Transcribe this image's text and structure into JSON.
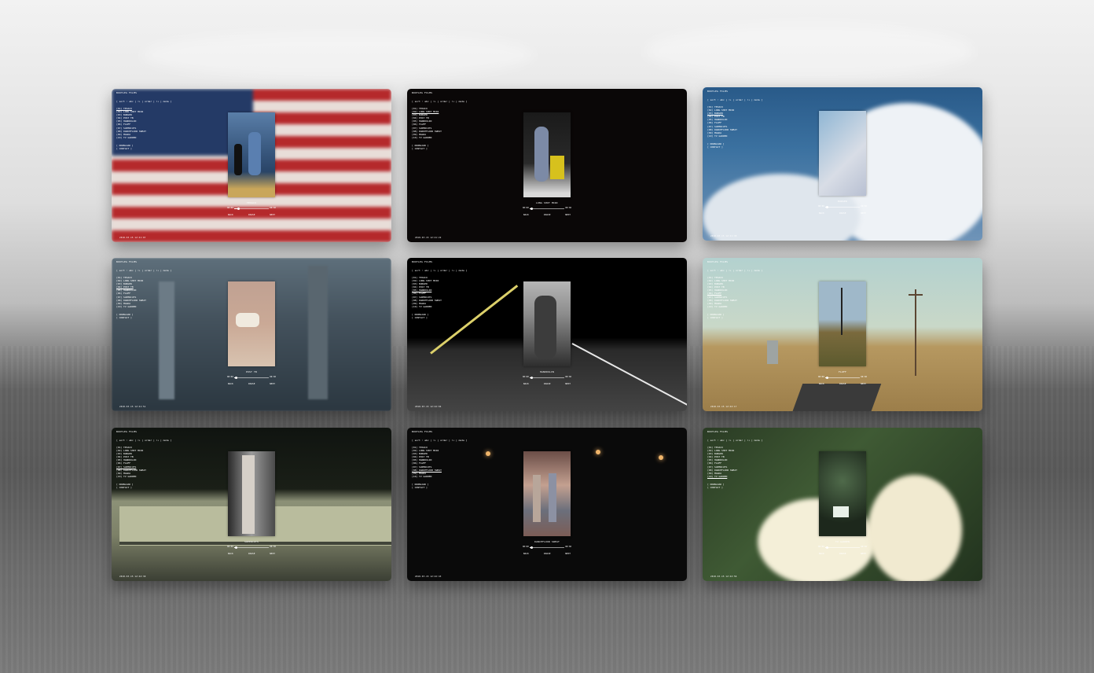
{
  "site_title": "BOOTLEG FILMS",
  "filter_label": "[ sort : abc | ↑↓ | order | ↑↓ | mode ]",
  "links": [
    "[ DOWNLOAD ]",
    "[ CONTACT ]"
  ],
  "controls": {
    "back": "BACK",
    "play": "PAUSE",
    "next": "NEXT"
  },
  "timeline": {
    "start": "00:00",
    "end": "00:30"
  },
  "tracks": [
    "[01] TEXACO",
    "[02] LONG SHOT MIRI",
    "[03] BURGER",
    "[04] POST TB",
    "[05] HANDDOLIN",
    "[06] FLUFF",
    "[07] SUPERCUTS",
    "[08] DANCEFLOOR SWEAT",
    "[09] MAGDA",
    "[10] TV GARDEN"
  ],
  "cards": [
    {
      "caption": "TEXACO",
      "active_index": 0,
      "progress": 0.12,
      "date": "2018.03.15 12:41:07"
    },
    {
      "caption": "LONG SHOT MIRI",
      "active_index": 1,
      "progress": 0.05,
      "date": "2018.03.15 12:41:22"
    },
    {
      "caption": "BURGER",
      "active_index": 2,
      "progress": 0.05,
      "date": "2018.03.15 12:41:38"
    },
    {
      "caption": "POST TB",
      "active_index": 3,
      "progress": 0.05,
      "date": "2018.03.15 12:41:51"
    },
    {
      "caption": "HANDDOLIN",
      "active_index": 4,
      "progress": 0.05,
      "date": "2018.03.15 12:42:04"
    },
    {
      "caption": "FLUFF",
      "active_index": 5,
      "progress": 0.05,
      "date": "2018.03.15 12:42:17"
    },
    {
      "caption": "SUPERCUTS",
      "active_index": 6,
      "progress": 0.05,
      "date": "2018.03.15 12:42:30"
    },
    {
      "caption": "DANCEFLOOR SWEAT",
      "active_index": 7,
      "progress": 0.05,
      "date": "2018.03.15 12:42:43"
    },
    {
      "caption": "TV GARDEN",
      "active_index": 9,
      "progress": 0.05,
      "date": "2018.03.15 12:42:56"
    }
  ]
}
